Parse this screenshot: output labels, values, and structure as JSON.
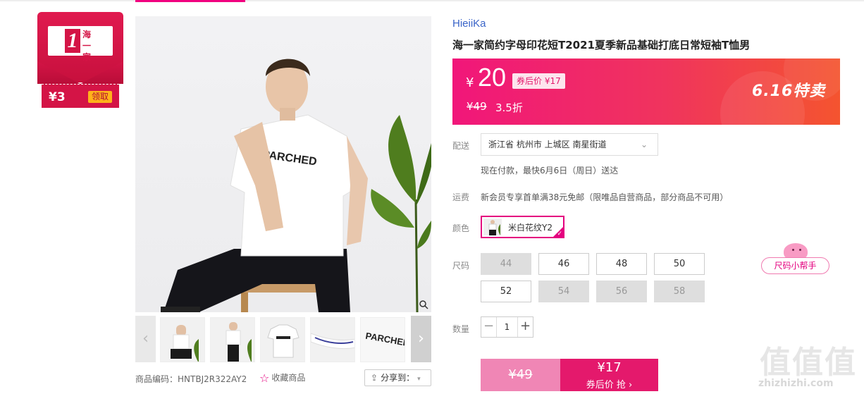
{
  "coupon": {
    "logo_number": "1",
    "logo_text": "海一家",
    "amount": "¥3",
    "claim_label": "领取"
  },
  "gallery": {
    "main_image_alt": "product photo",
    "prev_arrow": "‹",
    "next_arrow": "›",
    "thumbnails": [
      "thumb-1",
      "thumb-2",
      "thumb-3",
      "thumb-4",
      "thumb-5"
    ]
  },
  "meta": {
    "product_code": "商品编码：HNTBJ2R322AY2",
    "favorite_label": "收藏商品",
    "share_label": "分享到："
  },
  "product": {
    "brand": "HieiiKa",
    "title": "海一家简约字母印花短T2021夏季新品基础打底日常短袖T恤男"
  },
  "price": {
    "yen": "¥",
    "current": "20",
    "coupon_after": "券后价 ¥17",
    "original": "¥49",
    "discount": "3.5折",
    "promo": "6.16特卖"
  },
  "delivery": {
    "label": "配送",
    "address": "浙江省 杭州市 上城区 南星街道",
    "eta": "现在付款，最快6月6日（周日）送达"
  },
  "shipping": {
    "label": "运费",
    "text": "新会员专享首单满38元免邮（限唯品自营商品，部分商品不可用）"
  },
  "color": {
    "label": "颜色",
    "selected": "米白花纹Y2"
  },
  "size": {
    "label": "尺码",
    "options": [
      {
        "value": "44",
        "disabled": true
      },
      {
        "value": "46",
        "disabled": false
      },
      {
        "value": "48",
        "disabled": false
      },
      {
        "value": "50",
        "disabled": false
      },
      {
        "value": "52",
        "disabled": false
      },
      {
        "value": "54",
        "disabled": true
      },
      {
        "value": "56",
        "disabled": true
      },
      {
        "value": "58",
        "disabled": true
      }
    ],
    "helper": "尺码小帮手"
  },
  "quantity": {
    "label": "数量",
    "value": "1",
    "minus": "−",
    "plus": "+"
  },
  "buy": {
    "original": "¥49",
    "price": "¥17",
    "label": "券后价 抢 ›"
  },
  "watermark": {
    "big": "值值值",
    "small": "zhizhizhi.com"
  },
  "colors": {
    "accent": "#e4007f",
    "price_gradient_start": "#f1167a",
    "price_gradient_end": "#f4542f",
    "coupon_red": "#d41446"
  }
}
